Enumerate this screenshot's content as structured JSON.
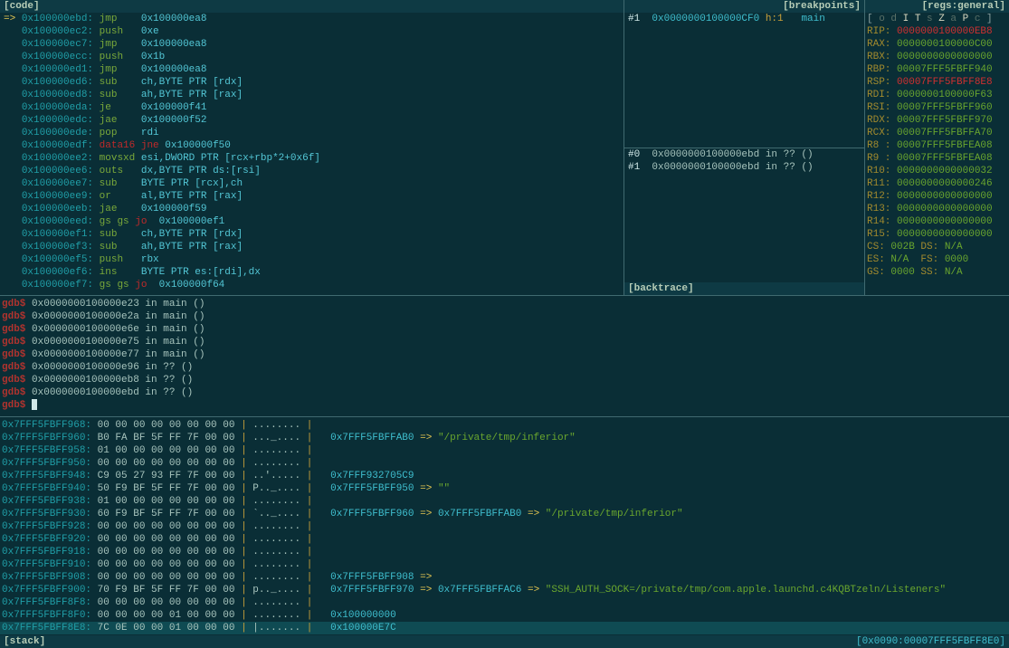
{
  "panes": {
    "code": {
      "title": "[code]"
    },
    "breakpoints": {
      "title": "[breakpoints]"
    },
    "backtrace": {
      "title": "[backtrace]"
    },
    "regs": {
      "title": "[regs:general]"
    },
    "stack": {
      "title": "[stack]"
    }
  },
  "footer_right": "[0x0090:00007FFF5FBFF8E0]",
  "pc_arrow": "=>",
  "code_lines": [
    {
      "a": "0x100000ebd:",
      "m": "jmp",
      "o": "0x100000ea8",
      "pc": true
    },
    {
      "a": "0x100000ec2:",
      "m": "push",
      "o": "0xe"
    },
    {
      "a": "0x100000ec7:",
      "m": "jmp",
      "o": "0x100000ea8"
    },
    {
      "a": "0x100000ecc:",
      "m": "push",
      "o": "0x1b"
    },
    {
      "a": "0x100000ed1:",
      "m": "jmp",
      "o": "0x100000ea8"
    },
    {
      "a": "0x100000ed6:",
      "m": "sub",
      "o": "ch,BYTE PTR [rdx]"
    },
    {
      "a": "0x100000ed8:",
      "m": "sub",
      "o": "ah,BYTE PTR [rax]"
    },
    {
      "a": "0x100000eda:",
      "m": "je",
      "o": "0x100000f41"
    },
    {
      "a": "0x100000edc:",
      "m": "jae",
      "o": "0x100000f52"
    },
    {
      "a": "0x100000ede:",
      "m": "pop",
      "o": "rdi"
    },
    {
      "a": "0x100000edf:",
      "m": "data16",
      "m2": "jne",
      "o": "0x100000f50",
      "red": true
    },
    {
      "a": "0x100000ee2:",
      "m": "movsxd",
      "o": "esi,DWORD PTR [rcx+rbp*2+0x6f]"
    },
    {
      "a": "0x100000ee6:",
      "m": "outs",
      "o": "dx,BYTE PTR ds:[rsi]"
    },
    {
      "a": "0x100000ee7:",
      "m": "sub",
      "o": "BYTE PTR [rcx],ch"
    },
    {
      "a": "0x100000ee9:",
      "m": "or",
      "o": "al,BYTE PTR [rax]"
    },
    {
      "a": "0x100000eeb:",
      "m": "jae",
      "o": "0x100000f59"
    },
    {
      "a": "0x100000eed:",
      "pre": "gs gs",
      "m": "jo",
      "o": "0x100000ef1",
      "red": true,
      "pregreen": true
    },
    {
      "a": "0x100000ef1:",
      "m": "sub",
      "o": "ch,BYTE PTR [rdx]"
    },
    {
      "a": "0x100000ef3:",
      "m": "sub",
      "o": "ah,BYTE PTR [rax]"
    },
    {
      "a": "0x100000ef5:",
      "m": "push",
      "o": "rbx"
    },
    {
      "a": "0x100000ef6:",
      "m": "ins",
      "o": "BYTE PTR es:[rdi],dx"
    },
    {
      "a": "0x100000ef7:",
      "pre": "gs gs",
      "m": "jo",
      "o": "0x100000f64",
      "red": true,
      "pregreen": true
    }
  ],
  "breakpoints": [
    {
      "idx": "#1",
      "addr": "0x0000000100000CF0",
      "hit": "h:1",
      "sym": "main"
    }
  ],
  "backtrace": [
    {
      "idx": "#0",
      "text": "0x0000000100000ebd in ?? ()"
    },
    {
      "idx": "#1",
      "text": "0x0000000100000ebd in ?? ()"
    }
  ],
  "regs_flags": "[ o d I T s Z a P c ]",
  "regs_flags_bracket_open": "[",
  "regs_flags_bracket_close": "]",
  "regs_flags_list": [
    {
      "c": "o",
      "on": false
    },
    {
      "c": "d",
      "on": false
    },
    {
      "c": "I",
      "on": true
    },
    {
      "c": "T",
      "on": true
    },
    {
      "c": "s",
      "on": false
    },
    {
      "c": "Z",
      "on": true
    },
    {
      "c": "a",
      "on": false
    },
    {
      "c": "P",
      "on": true
    },
    {
      "c": "c",
      "on": false
    }
  ],
  "regs": [
    {
      "n": "RIP:",
      "v": "0000000100000EB8",
      "red": true
    },
    {
      "n": "RAX:",
      "v": "0000000100000C00"
    },
    {
      "n": "RBX:",
      "v": "0000000000000000"
    },
    {
      "n": "RBP:",
      "v": "00007FFF5FBFF940"
    },
    {
      "n": "RSP:",
      "v": "00007FFF5FBFF8E8",
      "red": true
    },
    {
      "n": "RDI:",
      "v": "0000000100000F63"
    },
    {
      "n": "RSI:",
      "v": "00007FFF5FBFF960"
    },
    {
      "n": "RDX:",
      "v": "00007FFF5FBFF970"
    },
    {
      "n": "RCX:",
      "v": "00007FFF5FBFFA70"
    },
    {
      "n": "R8 :",
      "v": "00007FFF5FBFEA08"
    },
    {
      "n": "R9 :",
      "v": "00007FFF5FBFEA08"
    },
    {
      "n": "R10:",
      "v": "0000000000000032"
    },
    {
      "n": "R11:",
      "v": "0000000000000246"
    },
    {
      "n": "R12:",
      "v": "0000000000000000"
    },
    {
      "n": "R13:",
      "v": "0000000000000000"
    },
    {
      "n": "R14:",
      "v": "0000000000000000"
    },
    {
      "n": "R15:",
      "v": "0000000000000000"
    }
  ],
  "segregs": [
    {
      "l": "CS:",
      "lv": "002B",
      "r": "DS:",
      "rv": "N/A"
    },
    {
      "l": "ES:",
      "lv": "N/A",
      "r": "FS:",
      "rv": "0000"
    },
    {
      "l": "GS:",
      "lv": "0000",
      "r": "SS:",
      "rv": "N/A"
    }
  ],
  "gdb_prompt": "gdb$",
  "gdb_lines": [
    "0x0000000100000e23 in main ()",
    "0x0000000100000e2a in main ()",
    "0x0000000100000e6e in main ()",
    "0x0000000100000e75 in main ()",
    "0x0000000100000e77 in main ()",
    "0x0000000100000e96 in ?? ()",
    "0x0000000100000eb8 in ?? ()",
    "0x0000000100000ebd in ?? ()"
  ],
  "stack_lines": [
    {
      "a": "0x7FFF5FBFF968:",
      "h": "00 00 00 00 00 00 00 00",
      "t": "........"
    },
    {
      "a": "0x7FFF5FBFF960:",
      "h": "B0 FA BF 5F FF 7F 00 00",
      "t": "..._....",
      "p1": "0x7FFF5FBFFAB0",
      "arr1": "=>",
      "q": "\"/private/tmp/inferior\""
    },
    {
      "a": "0x7FFF5FBFF958:",
      "h": "01 00 00 00 00 00 00 00",
      "t": "........"
    },
    {
      "a": "0x7FFF5FBFF950:",
      "h": "00 00 00 00 00 00 00 00",
      "t": "........"
    },
    {
      "a": "0x7FFF5FBFF948:",
      "h": "C9 05 27 93 FF 7F 00 00",
      "t": "..'.....",
      "p1": "0x7FFF932705C9"
    },
    {
      "a": "0x7FFF5FBFF940:",
      "h": "50 F9 BF 5F FF 7F 00 00",
      "t": "P.._....",
      "p1": "0x7FFF5FBFF950",
      "arr1": "=>",
      "q": "\"\""
    },
    {
      "a": "0x7FFF5FBFF938:",
      "h": "01 00 00 00 00 00 00 00",
      "t": "........"
    },
    {
      "a": "0x7FFF5FBFF930:",
      "h": "60 F9 BF 5F FF 7F 00 00",
      "t": "`.._....",
      "p1": "0x7FFF5FBFF960",
      "arr1": "=>",
      "p2": "0x7FFF5FBFFAB0",
      "arr2": "=>",
      "q": "\"/private/tmp/inferior\""
    },
    {
      "a": "0x7FFF5FBFF928:",
      "h": "00 00 00 00 00 00 00 00",
      "t": "........"
    },
    {
      "a": "0x7FFF5FBFF920:",
      "h": "00 00 00 00 00 00 00 00",
      "t": "........"
    },
    {
      "a": "0x7FFF5FBFF918:",
      "h": "00 00 00 00 00 00 00 00",
      "t": "........"
    },
    {
      "a": "0x7FFF5FBFF910:",
      "h": "00 00 00 00 00 00 00 00",
      "t": "........"
    },
    {
      "a": "0x7FFF5FBFF908:",
      "h": "00 00 00 00 00 00 00 00",
      "t": "........",
      "p1": "0x7FFF5FBFF908",
      "arr1": "=>"
    },
    {
      "a": "0x7FFF5FBFF900:",
      "h": "70 F9 BF 5F FF 7F 00 00",
      "t": "p.._....",
      "p1": "0x7FFF5FBFF970",
      "arr1": "=>",
      "p2": "0x7FFF5FBFFAC6",
      "arr2": "=>",
      "q": "\"SSH_AUTH_SOCK=/private/tmp/com.apple.launchd.c4KQBTzeln/Listeners\""
    },
    {
      "a": "0x7FFF5FBFF8F8:",
      "h": "00 00 00 00 00 00 00 00",
      "t": "........"
    },
    {
      "a": "0x7FFF5FBFF8F0:",
      "h": "00 00 00 00 01 00 00 00",
      "t": "........",
      "p1": "0x100000000"
    },
    {
      "a": "0x7FFF5FBFF8E8:",
      "h": "7C 0E 00 00 01 00 00 00",
      "t": "|.......",
      "p1": "0x100000E7C",
      "hl": true
    }
  ]
}
